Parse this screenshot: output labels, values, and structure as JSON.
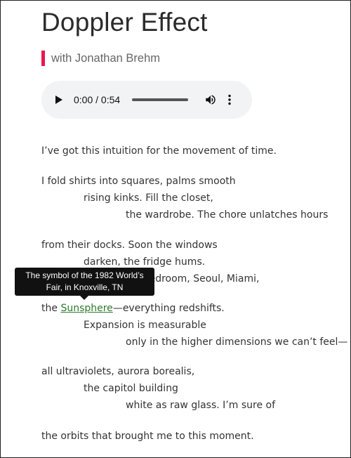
{
  "title": "Doppler Effect",
  "byline": "with Jonathan Brehm",
  "accent_color": "#e8174f",
  "link_color": "#2f7a2f",
  "player": {
    "time": "0:00 / 0:54",
    "progress": 0,
    "play_icon": "play-icon",
    "volume_icon": "volume-icon",
    "menu_icon": "more-vertical-icon"
  },
  "poem": {
    "l1": "I’ve got this intuition for the movement of time.",
    "l2": "I fold shirts into squares, palms smooth",
    "l3": "rising kinks. Fill the closet,",
    "l4": "the wardrobe. The chore unlatches hours",
    "l5": "from their docks. Soon the windows",
    "l6": "darken, the fridge hums.",
    "l7": "Beyond the bedroom, Seoul, Miami,",
    "l8_pre": "the ",
    "l8_link": "Sunsphere",
    "l8_post": "—everything redshifts.",
    "l9": "Expansion is measurable",
    "l10": "only in the higher dimensions we can’t feel—",
    "l11": "all ultraviolets, aurora borealis,",
    "l12": "the capitol building",
    "l13": "white as raw glass. I’m sure of",
    "l14": "the orbits that brought me to this moment."
  },
  "tooltip": {
    "line1": "The symbol of the 1982 World’s",
    "line2": "Fair, in Knoxville, TN"
  }
}
